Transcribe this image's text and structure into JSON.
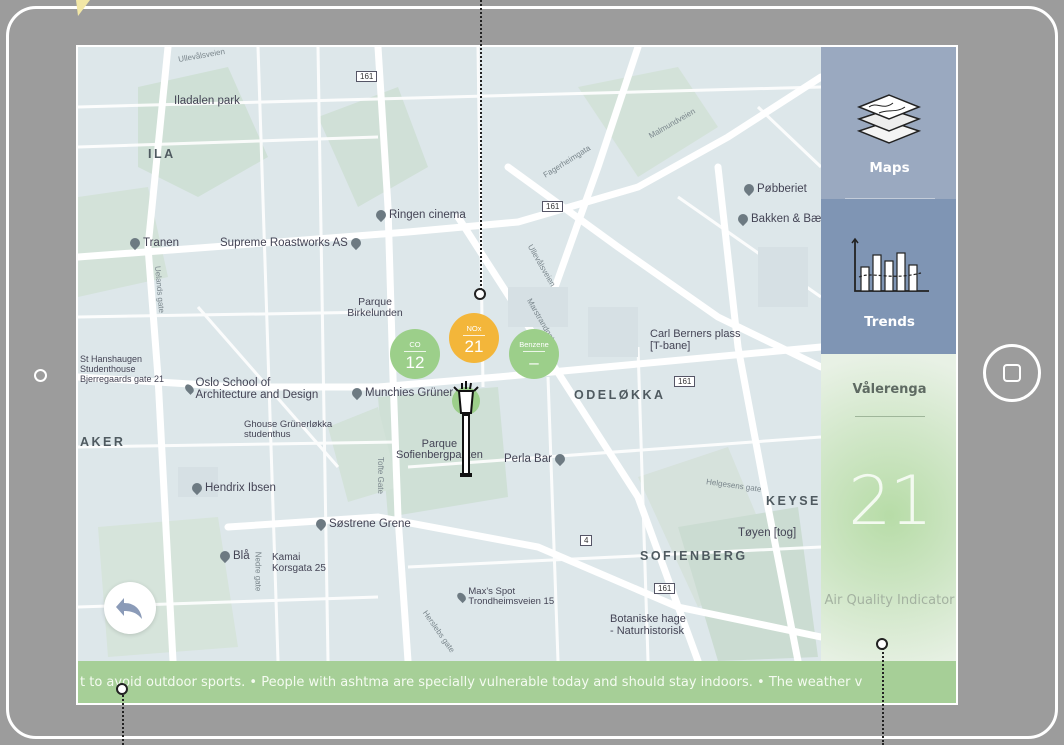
{
  "map": {
    "district_labels": [
      "ODELØKKA",
      "SOFIENBERG",
      "KEYSE",
      "AKER",
      "ILA"
    ],
    "places": [
      {
        "name": "Iladalen park"
      },
      {
        "name": "Ringen cinema"
      },
      {
        "name": "Tranen"
      },
      {
        "name": "Supreme Roastworks AS"
      },
      {
        "name": "Pøbberiet"
      },
      {
        "name": "Bakken & Bæ"
      },
      {
        "name": "Parque Birkelunden"
      },
      {
        "name": "Carl Berners plass [T-bane]"
      },
      {
        "name": "St Hanshaugen Studenthouse Bjerregaards gate 21"
      },
      {
        "name": "Oslo School of Architecture and Design"
      },
      {
        "name": "Munchies Grüner"
      },
      {
        "name": "Ghouse Grünerløkka studenthus"
      },
      {
        "name": "Parque Sofienbergparken"
      },
      {
        "name": "Perla Bar"
      },
      {
        "name": "Hendrix Ibsen"
      },
      {
        "name": "Søstrene Grene"
      },
      {
        "name": "Tøyen [tog]"
      },
      {
        "name": "Blå"
      },
      {
        "name": "Kamai Korsgata 25"
      },
      {
        "name": "Max's Spot Trondheimsveien 15"
      },
      {
        "name": "Botaniske hage - Naturhistorisk"
      }
    ],
    "streets": [
      "Ullevålsveien",
      "Fagerheimgata",
      "Malmundveien",
      "Ullevålsveien",
      "Marstrandgata",
      "Tofte Gate",
      "Herslebs gate",
      "Uelands gate",
      "Helgesens gate",
      "Nedre gate"
    ],
    "road_numbers": [
      "161",
      "161",
      "161",
      "4",
      "161"
    ]
  },
  "sensors": [
    {
      "label": "CO",
      "value": "12",
      "color": "#9ccf8a"
    },
    {
      "label": "NOx",
      "value": "21",
      "color": "#f3b63a"
    },
    {
      "label": "Benzene",
      "value": "–",
      "color": "#9ccf8a"
    }
  ],
  "sidebar": {
    "maps_label": "Maps",
    "trends_label": "Trends",
    "neighborhood": "Vålerenga",
    "aqi_value": "21",
    "aqi_caption": "Air Quality Indicator"
  },
  "ticker": {
    "text": "t to avoid outdoor sports.  • People with ashtma are specially vulnerable today and should stay indoors. • The weather v"
  },
  "icons": {
    "back": "back-arrow-icon",
    "maps": "layers-icon",
    "trends": "chart-icon",
    "home": "home-square-icon"
  },
  "colors": {
    "frame_bg": "#9c9c9c",
    "maps_nav": "#9aa9c0",
    "trends_nav": "#7f95b4",
    "ticker_bg": "#a6cf97",
    "nox_orange": "#f3b63a",
    "good_green": "#9ccf8a"
  }
}
